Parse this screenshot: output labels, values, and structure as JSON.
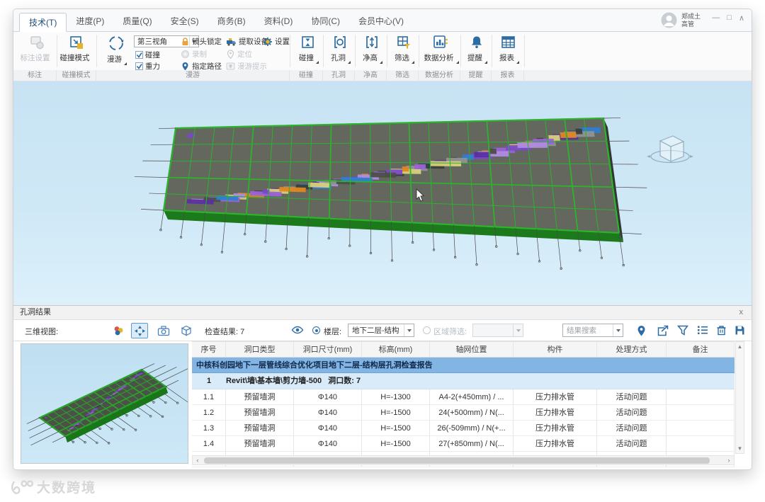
{
  "window_controls": {
    "minimize": "—",
    "maximize": "□",
    "collapse": "∧"
  },
  "menu": {
    "tabs": [
      "技术(T)",
      "进度(P)",
      "质量(Q)",
      "安全(S)",
      "商务(B)",
      "资料(D)",
      "协同(C)",
      "会员中心(V)"
    ]
  },
  "user": {
    "name": "郑成土",
    "role": "高管"
  },
  "ribbon": {
    "annotation": {
      "group": "标注",
      "settings": "标注设置"
    },
    "collision_mode": {
      "group": "碰撞模式",
      "button": "碰撞模式"
    },
    "roam": {
      "group": "漫游",
      "button": "漫游",
      "view_mode": "第三视角",
      "collision": "碰撞",
      "gravity": "重力",
      "camera_lock": "镜头锁定",
      "record": "录制",
      "specify_path": "指定路径",
      "extract_device": "提取设备",
      "locate": "定位",
      "roam_tip": "漫游提示",
      "settings": "设置"
    },
    "big_buttons": [
      "碰撞",
      "孔洞",
      "净高",
      "筛选",
      "数据分析",
      "提醒",
      "报表"
    ]
  },
  "panel": {
    "title": "孔洞结果",
    "close": "x",
    "toolbar": {
      "view_label": "三维视图:",
      "check_result": "检查结果: 7",
      "floor_label": "楼层:",
      "floor_value": "地下二层-结构",
      "region_label": "区域筛选:",
      "search_placeholder": "结果搜索"
    },
    "table": {
      "headers": [
        "序号",
        "洞口类型",
        "洞口尺寸(mm)",
        "标高(mm)",
        "轴网位置",
        "构件",
        "处理方式",
        "备注"
      ],
      "report_title": "中核科创园地下一层管线综合优化项目地下二层-结构层孔洞检查报告",
      "group": {
        "index": "1",
        "name": "Revit\\墙\\基本墙\\剪力墙-500",
        "count": "洞口数: 7"
      },
      "rows": [
        {
          "cells": [
            "1.1",
            "预留墙洞",
            "Φ140",
            "H=-1300",
            "A4-2(+450mm) / ...",
            "压力排水管",
            "活动问题",
            ""
          ]
        },
        {
          "cells": [
            "1.2",
            "预留墙洞",
            "Φ140",
            "H=-1500",
            "24(+500mm) / N(...",
            "压力排水管",
            "活动问题",
            ""
          ]
        },
        {
          "cells": [
            "1.3",
            "预留墙洞",
            "Φ140",
            "H=-1500",
            "26(-509mm) / N(+...",
            "压力排水管",
            "活动问题",
            ""
          ]
        },
        {
          "cells": [
            "1.4",
            "预留墙洞",
            "Φ140",
            "H=-1500",
            "27(+850mm) / N(...",
            "压力排水管",
            "活动问题",
            ""
          ]
        }
      ]
    }
  },
  "watermark": {
    "text": "大数跨境"
  }
}
